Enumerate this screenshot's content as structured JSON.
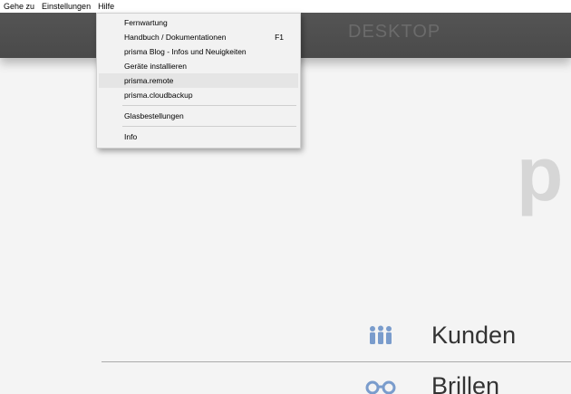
{
  "menubar": {
    "items": [
      "Gehe zu",
      "Einstellungen",
      "Hilfe"
    ]
  },
  "header": {
    "title": "DESKTOP"
  },
  "help_menu": {
    "items": [
      {
        "label": "Fernwartung",
        "shortcut": ""
      },
      {
        "label": "Handbuch / Dokumentationen",
        "shortcut": "F1"
      },
      {
        "label": "prisma Blog - Infos und Neuigkeiten",
        "shortcut": ""
      },
      {
        "label": "Geräte installieren",
        "shortcut": ""
      },
      {
        "label": "prisma.remote",
        "shortcut": ""
      },
      {
        "label": "prisma.cloudbackup",
        "shortcut": ""
      },
      {
        "label": "Glasbestellungen",
        "shortcut": ""
      },
      {
        "label": "Info",
        "shortcut": ""
      }
    ]
  },
  "brand_partial": "p",
  "nav": {
    "items": [
      {
        "label": "Kunden",
        "icon": "people-icon"
      },
      {
        "label": "Brillen",
        "icon": "glasses-icon"
      }
    ]
  },
  "colors": {
    "header": "#4f4f4f",
    "icon_blue": "#7a9ccc",
    "menu_bg": "#f2f2f2"
  }
}
